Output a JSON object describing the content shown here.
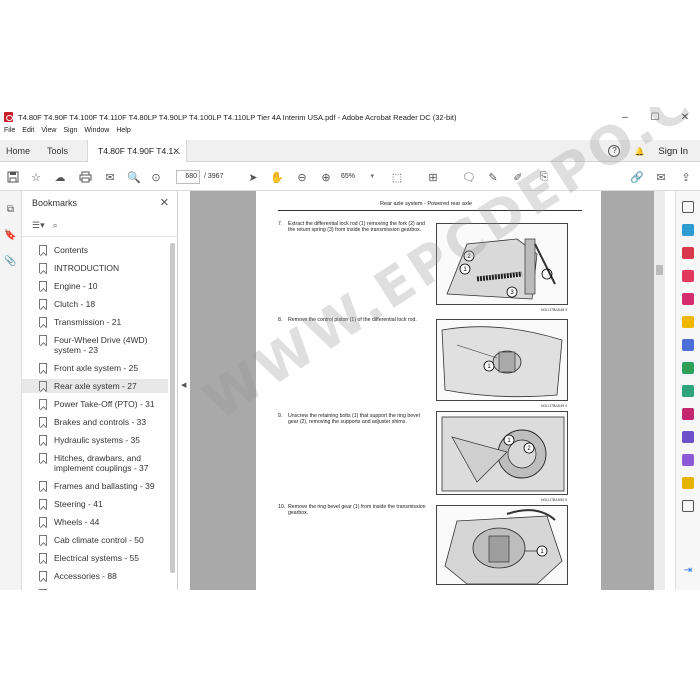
{
  "window": {
    "title": "T4.80F T4.90F T4.100F T4.110F T4.80LP T4.90LP T4.100LP T4.110LP Tier 4A Interim USA.pdf - Adobe Acrobat Reader DC (32-bit)",
    "minimize": "–",
    "maximize": "☐",
    "close": "✕"
  },
  "menu": [
    "File",
    "Edit",
    "View",
    "Sign",
    "Window",
    "Help"
  ],
  "tabs": {
    "home": "Home",
    "tools": "Tools",
    "document": "T4.80F T4.90F T4.1...",
    "close": "✕",
    "help_icon": "?",
    "bell_icon": "🔔",
    "sign_in": "Sign In"
  },
  "toolbar": {
    "page_current": "680",
    "page_total": "/  3967",
    "zoom": "65%"
  },
  "bookmarks": {
    "title": "Bookmarks",
    "close": "✕",
    "options_icon": "☰▾",
    "find_icon": "⌕",
    "items": [
      "Contents",
      "INTRODUCTION",
      "Engine - 10",
      "Clutch - 18",
      "Transmission - 21",
      "Four-Wheel Drive (4WD) system - 23",
      "Front axle system - 25",
      "Rear axle system - 27",
      "Power Take-Off (PTO) - 31",
      "Brakes and controls - 33",
      "Hydraulic systems - 35",
      "Hitches, drawbars, and implement couplings - 37",
      "Frames and ballasting - 39",
      "Steering - 41",
      "Wheels - 44",
      "Cab climate control - 50",
      "Electrical systems - 55",
      "Accessories - 88",
      "Platform, cab, bodywork, and"
    ],
    "active_index": 7
  },
  "document": {
    "header": "Rear axle system - Powered rear axle",
    "steps": [
      {
        "num": "7.",
        "text": "Extract the differential lock rod (1) removing the fork (2) and the return spring (3) from inside the transmission gearbox.",
        "caption": "NOLI17BAD48   3"
      },
      {
        "num": "8.",
        "text": "Remove the control piston (1) of the differential lock rod.",
        "caption": "NOLI17BAD49   4"
      },
      {
        "num": "9.",
        "text": "Unscrew the retaining bolts (1) that support the ring bevel gear (2), removing the supports and adjuster shims.",
        "caption": "NOLI17BAD50   5"
      },
      {
        "num": "10.",
        "text": "Remove the ring bevel gear (1) from inside the transmission gearbox.",
        "caption": "NOLI17BAD51   6"
      }
    ],
    "callouts": [
      "2",
      "1",
      "3",
      "1",
      "1",
      "2",
      "1"
    ]
  },
  "watermark": "WWW.EPCDEPO.COM",
  "colors": {
    "doc_background": "#a9a9a9",
    "acrobat_red": "#c8202a",
    "active_bookmark": "#e8e8e8"
  }
}
